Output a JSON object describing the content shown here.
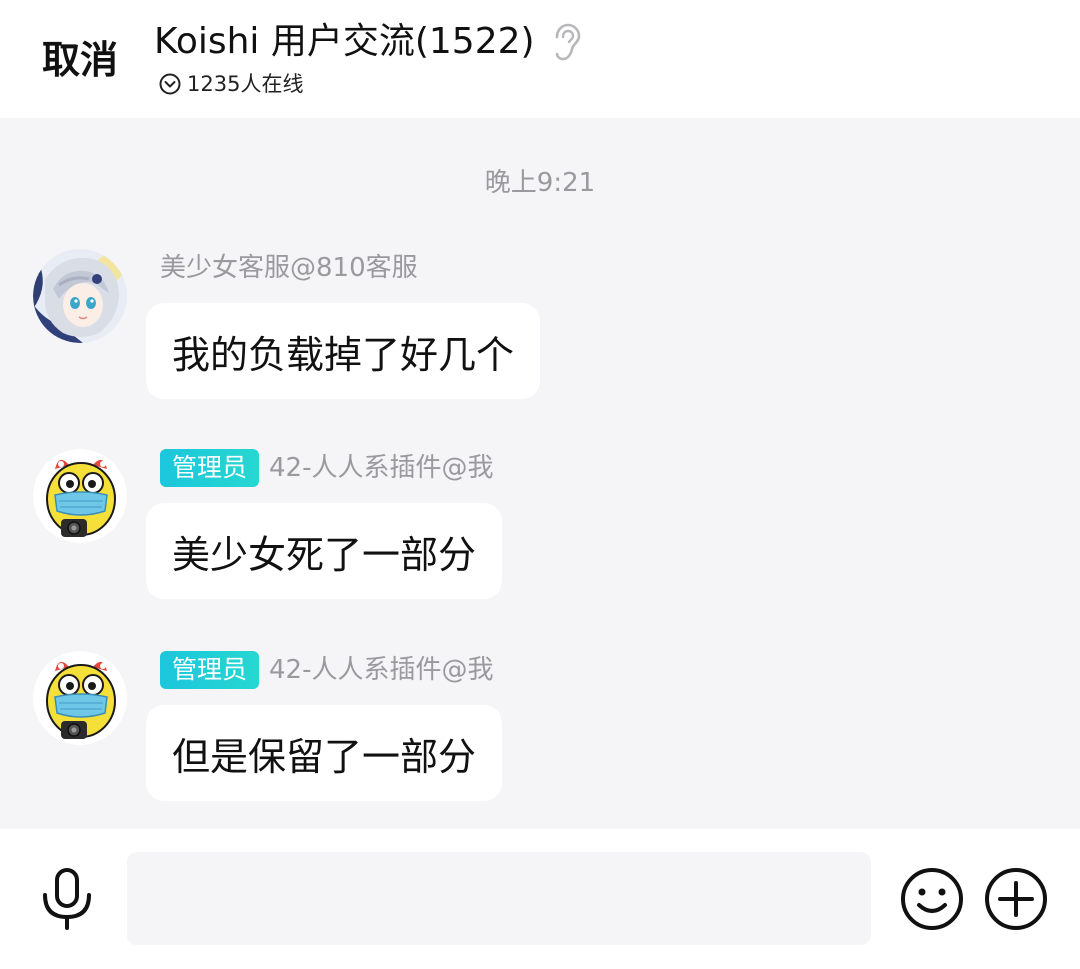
{
  "header": {
    "cancel_label": "取消",
    "title": "Koishi 用户交流(1522)",
    "online_status": "1235人在线",
    "ear_icon": "ear-icon",
    "collapse_icon": "chevron-down-circle-icon"
  },
  "chat": {
    "time_divider": "晚上9:21",
    "messages": [
      {
        "sender": "美少女客服@810客服",
        "role": "",
        "text": "我的负载掉了好几个",
        "avatar": "anime-girl-avatar"
      },
      {
        "sender": "42-人人系插件@我",
        "role": "管理员",
        "text": "美少女死了一部分",
        "avatar": "yellow-mascot-avatar"
      },
      {
        "sender": "42-人人系插件@我",
        "role": "管理员",
        "text": "但是保留了一部分",
        "avatar": "yellow-mascot-avatar"
      }
    ]
  },
  "input_bar": {
    "placeholder": "",
    "value": "",
    "mic_icon": "microphone-icon",
    "emoji_icon": "smiley-icon",
    "plus_icon": "plus-circle-icon"
  },
  "colors": {
    "background": "#f5f4f6",
    "bubble": "#ffffff",
    "badge_gradient_start": "#1cc6dc",
    "badge_gradient_end": "#27d7d1",
    "meta_text": "#9a9a9e"
  }
}
